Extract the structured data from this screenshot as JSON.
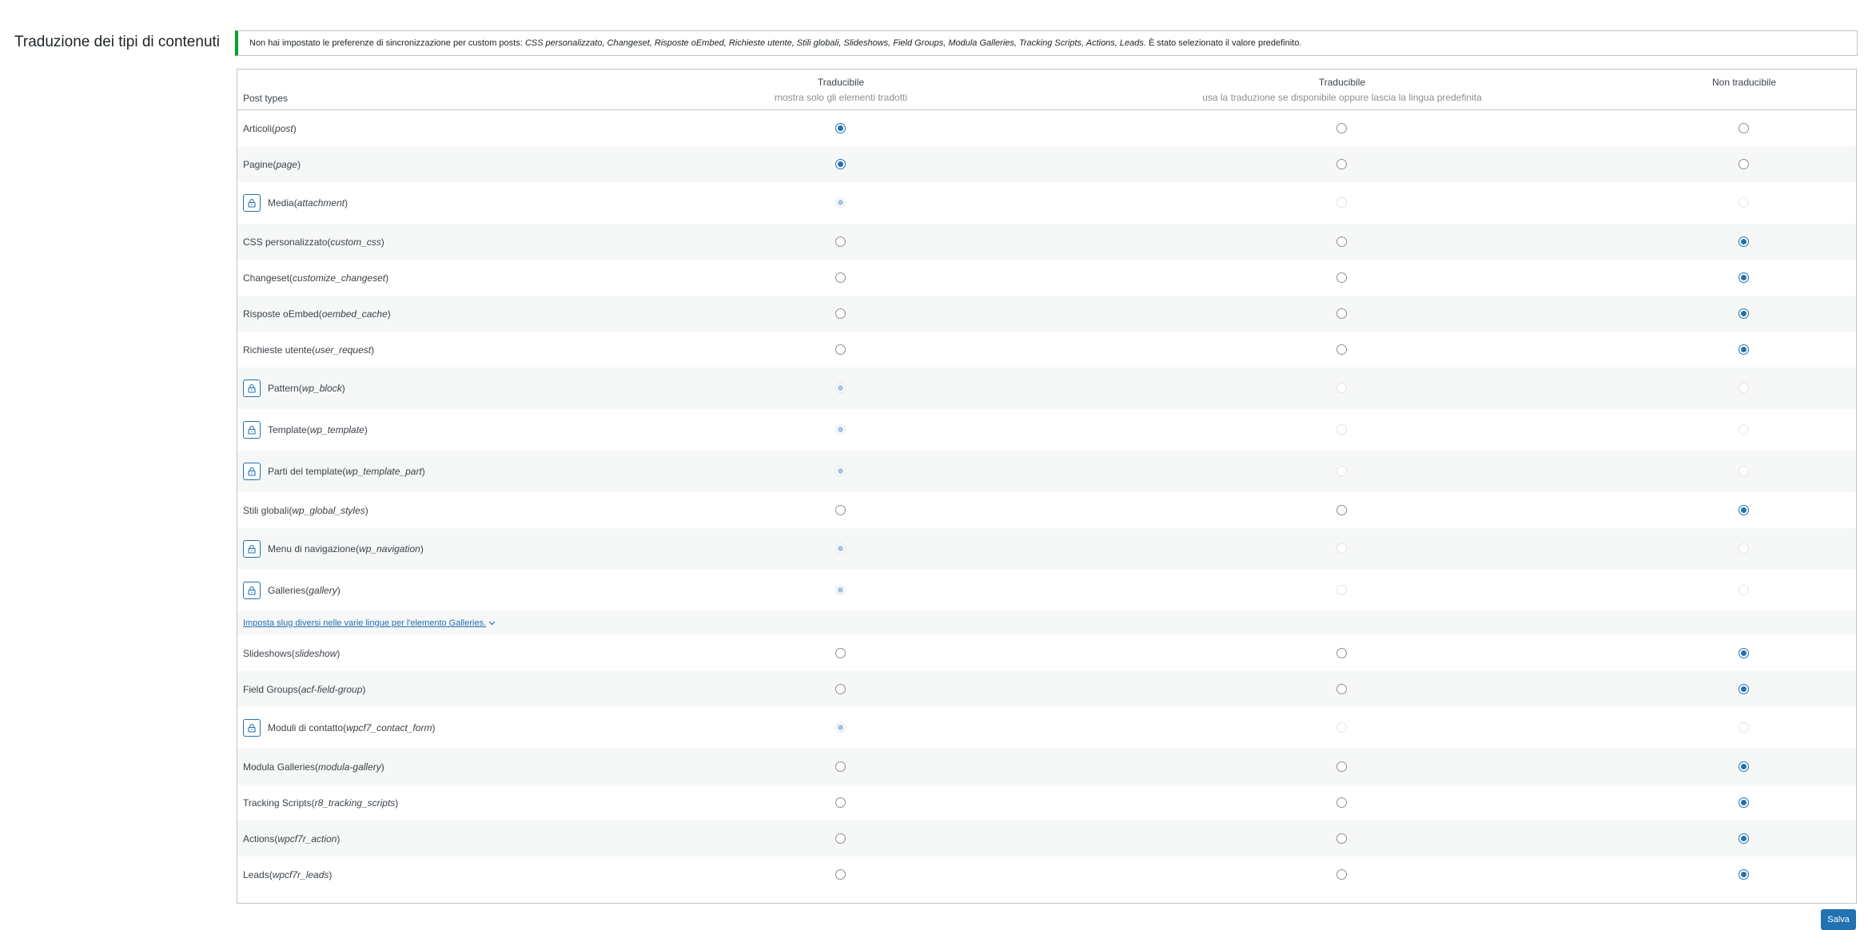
{
  "section_title": "Traduzione dei tipi di contenuti",
  "notice": {
    "prefix": "Non hai impostato le preferenze di sincronizzazione per custom posts: ",
    "types": "CSS personalizzato, Changeset, Risposte oEmbed, Richieste utente, Stili globali, Slideshows, Field Groups, Modula Galleries, Tracking Scripts, Actions, Leads.",
    "suffix": " È stato selezionato il valore predefinito."
  },
  "table": {
    "post_types_header": "Post types",
    "columns": [
      {
        "label": "Traducibile",
        "sub": "mostra solo gli elementi tradotti"
      },
      {
        "label": "Traducibile",
        "sub": "usa la traduzione se disponibile oppure lascia la lingua predefinita"
      },
      {
        "label": "Non traducibile",
        "sub": ""
      }
    ],
    "rows": [
      {
        "label": "Articoli",
        "slug": "post",
        "locked": false,
        "selected": 0
      },
      {
        "label": "Pagine",
        "slug": "page",
        "locked": false,
        "selected": 0
      },
      {
        "label": "Media",
        "slug": "attachment",
        "locked": true,
        "selected": 0
      },
      {
        "label": "CSS personalizzato",
        "slug": "custom_css",
        "locked": false,
        "selected": 2
      },
      {
        "label": "Changeset",
        "slug": "customize_changeset",
        "locked": false,
        "selected": 2
      },
      {
        "label": "Risposte oEmbed",
        "slug": "oembed_cache",
        "locked": false,
        "selected": 2
      },
      {
        "label": "Richieste utente",
        "slug": "user_request",
        "locked": false,
        "selected": 2
      },
      {
        "label": "Pattern",
        "slug": "wp_block",
        "locked": true,
        "selected": 0
      },
      {
        "label": "Template",
        "slug": "wp_template",
        "locked": true,
        "selected": 0
      },
      {
        "label": "Parti del template",
        "slug": "wp_template_part",
        "locked": true,
        "selected": 0
      },
      {
        "label": "Stili globali",
        "slug": "wp_global_styles",
        "locked": false,
        "selected": 2
      },
      {
        "label": "Menu di navigazione",
        "slug": "wp_navigation",
        "locked": true,
        "selected": 0
      },
      {
        "label": "Galleries",
        "slug": "gallery",
        "locked": true,
        "selected": 0
      },
      {
        "link": "Imposta slug diversi nelle varie lingue per l'elemento Galleries."
      },
      {
        "label": "Slideshows",
        "slug": "slideshow",
        "locked": false,
        "selected": 2
      },
      {
        "label": "Field Groups",
        "slug": "acf-field-group",
        "locked": false,
        "selected": 2
      },
      {
        "label": "Moduli di contatto",
        "slug": "wpcf7_contact_form",
        "locked": true,
        "selected": 0
      },
      {
        "label": "Modula Galleries",
        "slug": "modula-gallery",
        "locked": false,
        "selected": 2
      },
      {
        "label": "Tracking Scripts",
        "slug": "r8_tracking_scripts",
        "locked": false,
        "selected": 2
      },
      {
        "label": "Actions",
        "slug": "wpcf7r_action",
        "locked": false,
        "selected": 2
      },
      {
        "label": "Leads",
        "slug": "wpcf7r_leads",
        "locked": false,
        "selected": 2
      }
    ]
  },
  "save_label": "Salva",
  "colors": {
    "accent": "#2271b1",
    "notice_border": "#00a32a"
  }
}
